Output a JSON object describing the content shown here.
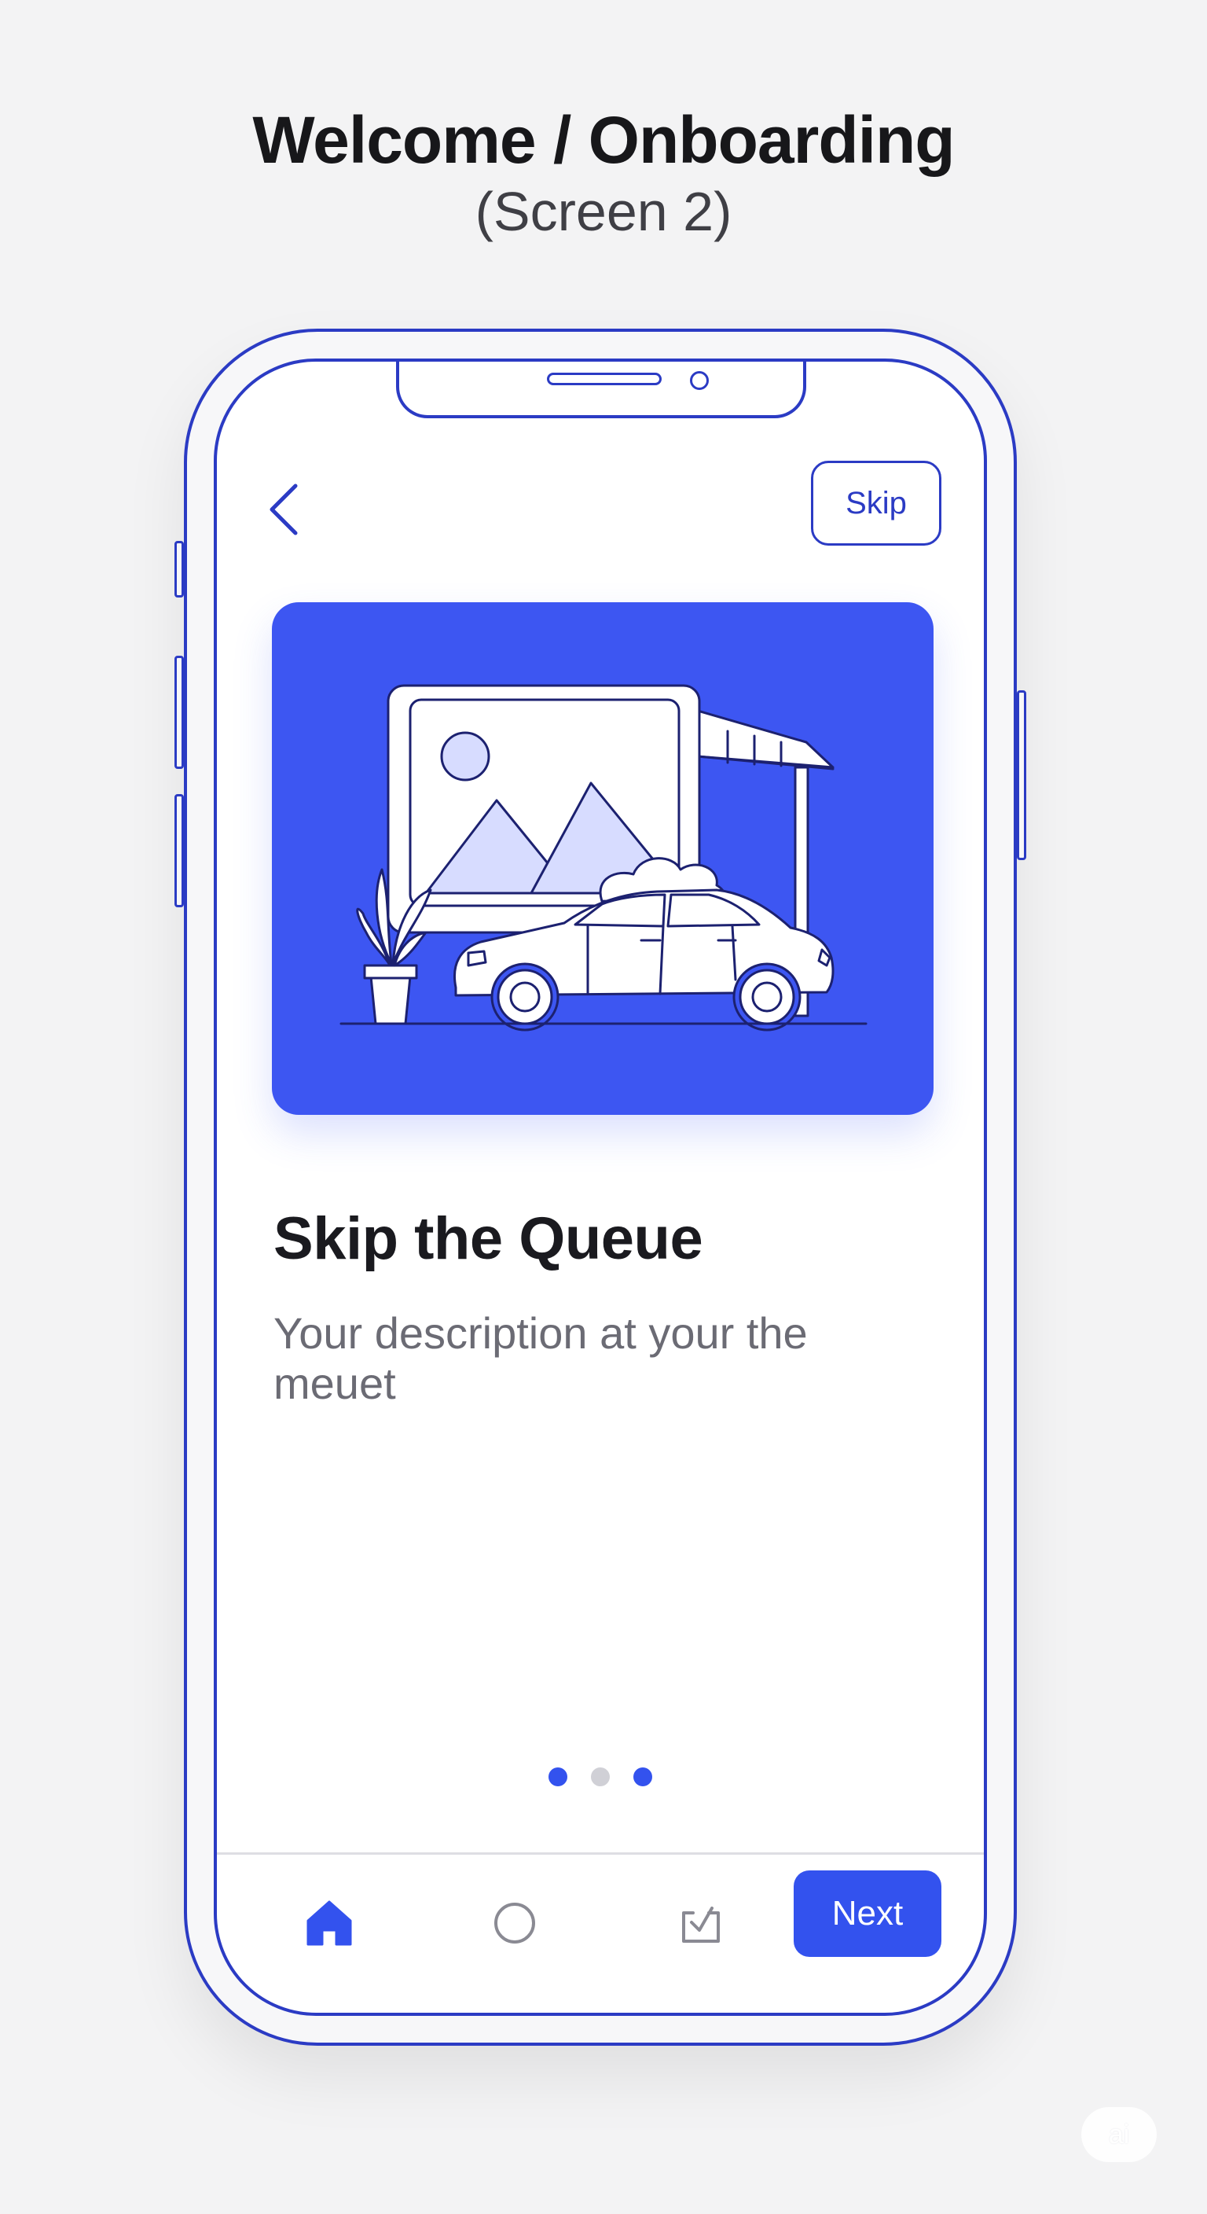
{
  "header": {
    "title": "Welcome / Onboarding",
    "subtitle": "(Screen 2)"
  },
  "top_bar": {
    "back_icon": "chevron-left-icon",
    "skip_label": "Skip"
  },
  "hero": {
    "illustration": "image-frame-with-car-plant-illustration",
    "background_color": "#3d56f2"
  },
  "content": {
    "title": "Skip the Queue",
    "description": "Your description at your the meuet"
  },
  "pagination": {
    "dot_states": [
      "active",
      "inactive",
      "active"
    ]
  },
  "bottom_nav": {
    "icons": [
      "home-icon",
      "circle-icon",
      "inbox-check-icon"
    ],
    "next_label": "Next"
  },
  "watermark": {
    "text": "ai"
  },
  "colors": {
    "accent": "#3352ee",
    "outline": "#2b3bc4",
    "title_text": "#1a1a1f",
    "body_text": "#6b6b74"
  }
}
